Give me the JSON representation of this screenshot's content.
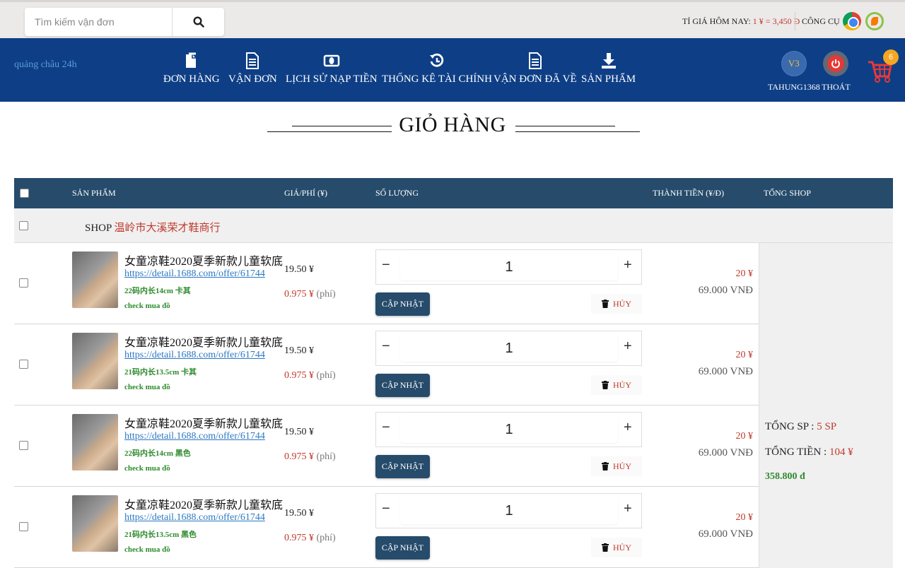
{
  "search": {
    "placeholder": "Tìm kiếm vận đơn"
  },
  "topbar": {
    "rate_label": "TỈ GIÁ HÔM NAY:",
    "rate_value": "1 ¥ = 3,450 Đ",
    "tools_label": "CÔNG CỤ"
  },
  "logo": {
    "alt": "quảng châu 24h"
  },
  "nav": [
    {
      "label": "ĐƠN HÀNG",
      "icon": "document-icon"
    },
    {
      "label": "VẬN ĐƠN",
      "icon": "file-text-icon"
    },
    {
      "label": "LỊCH SỬ NẠP TIỀN",
      "icon": "money-icon"
    },
    {
      "label": "THỐNG KÊ TÀI CHÍNH",
      "icon": "history-icon"
    },
    {
      "label": "VẬN ĐƠN ĐÃ VỀ",
      "icon": "file-text-icon"
    },
    {
      "label": "SẢN PHẨM",
      "icon": "download-icon"
    }
  ],
  "user": {
    "level": "V3",
    "username": "TAHUNG1368",
    "logout_label": "THOÁT"
  },
  "cart": {
    "count": "6"
  },
  "page": {
    "title": "GIỎ HÀNG"
  },
  "table": {
    "headers": {
      "product": "SẢN PHẨM",
      "price": "GIÁ/PHÍ (¥)",
      "quantity": "SỐ LƯỢNG",
      "amount": "THÀNH TIỀN (¥/Đ)",
      "shop_total": "TỔNG SHOP"
    },
    "shop": {
      "prefix": "SHOP",
      "name": "温岭市大溪荣才鞋商行"
    },
    "update_label": "CẬP NHẬT",
    "delete_label": "HỦY",
    "fee_suffix": "(phí)",
    "rows": [
      {
        "name": "女童凉鞋2020夏季新款儿童软底",
        "link": "https://detail.1688.com/offer/61744",
        "variant": "22码内长14cm 卡其",
        "check": "check mua đồ",
        "price": "19.50 ¥",
        "fee": "0.975 ¥",
        "qty": "1",
        "amount": "20 ¥",
        "vnd": "69.000 VNĐ"
      },
      {
        "name": "女童凉鞋2020夏季新款儿童软底",
        "link": "https://detail.1688.com/offer/61744",
        "variant": "21码内长13.5cm 卡其",
        "check": "check mua đồ",
        "price": "19.50 ¥",
        "fee": "0.975 ¥",
        "qty": "1",
        "amount": "20 ¥",
        "vnd": "69.000 VNĐ"
      },
      {
        "name": "女童凉鞋2020夏季新款儿童软底",
        "link": "https://detail.1688.com/offer/61744",
        "variant": "22码内长14cm 黑色",
        "check": "check mua đồ",
        "price": "19.50 ¥",
        "fee": "0.975 ¥",
        "qty": "1",
        "amount": "20 ¥",
        "vnd": "69.000 VNĐ"
      },
      {
        "name": "女童凉鞋2020夏季新款儿童软底",
        "link": "https://detail.1688.com/offer/61744",
        "variant": "21码内长13.5cm 黑色",
        "check": "check mua đồ",
        "price": "19.50 ¥",
        "fee": "0.975 ¥",
        "qty": "1",
        "amount": "20 ¥",
        "vnd": "69.000 VNĐ"
      }
    ]
  },
  "summary": {
    "total_items_label": "TỔNG SP :",
    "total_items_value": "5 SP",
    "total_money_label": "TỔNG TIỀN :",
    "total_money_value": "104 ¥",
    "total_vnd": "358.800 đ"
  },
  "colors": {
    "navbar": "#0e3f86",
    "table_header": "#264b6b",
    "accent_red": "#c0392b",
    "accent_green": "#2e8b2e"
  }
}
